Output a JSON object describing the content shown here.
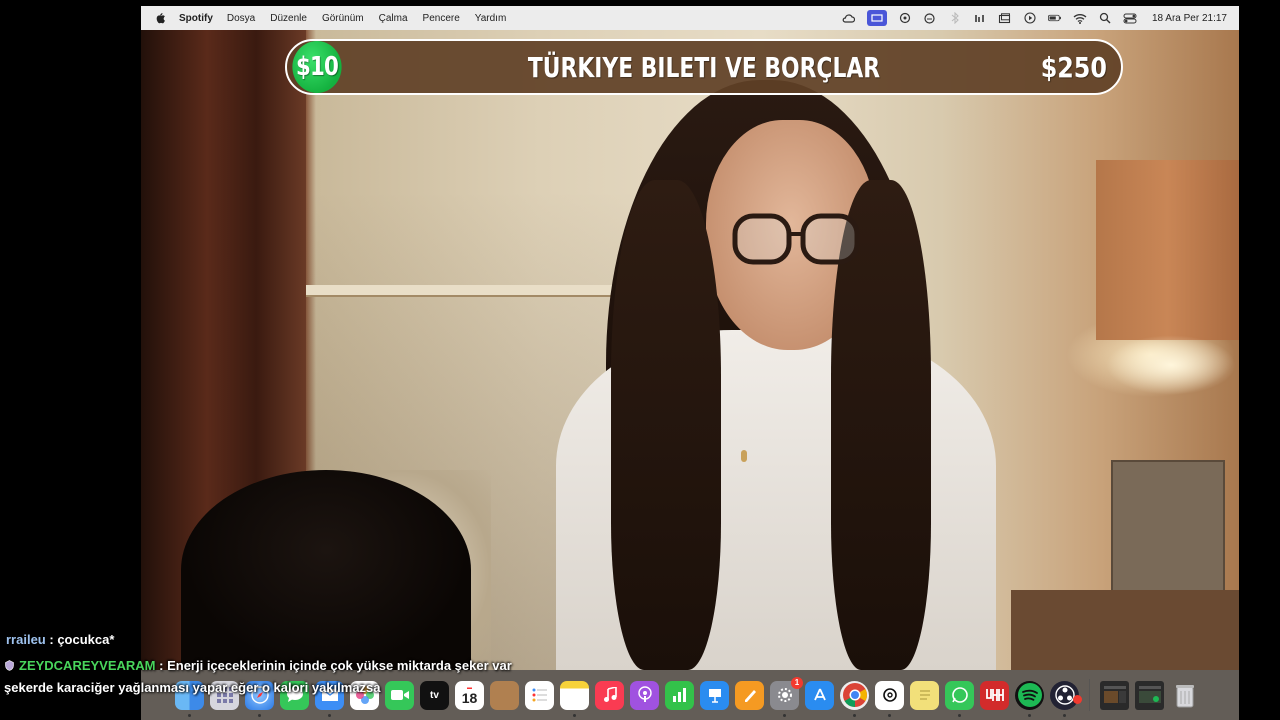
{
  "menubar": {
    "app_name": "Spotify",
    "menus": [
      "Dosya",
      "Düzenle",
      "Görünüm",
      "Çalma",
      "Pencere",
      "Yardım"
    ],
    "status_icons": [
      "creative-cloud-icon",
      "screen-mirroring-icon",
      "chatgpt-icon",
      "cloud-icon",
      "bluetooth-icon",
      "window-icon",
      "play-icon",
      "battery-icon",
      "wifi-icon",
      "search-icon",
      "control-center-icon"
    ],
    "clock": "18 Ara Per  21:17",
    "active_color": "#4a56d8"
  },
  "banner": {
    "left_amount": "$10",
    "title": "TÜRKIYE BILETI VE BORÇLAR",
    "right_amount": "$250",
    "accent_color": "#1db954"
  },
  "dock": {
    "apps": [
      {
        "name": "finder",
        "color": "#4aa3f0"
      },
      {
        "name": "launchpad",
        "color": "#d0d0d8"
      },
      {
        "name": "safari",
        "color": "#3b8ef0"
      },
      {
        "name": "messages",
        "color": "#35c759"
      },
      {
        "name": "mail",
        "color": "#3d8ef5"
      },
      {
        "name": "photos",
        "color": "#f5a623"
      },
      {
        "name": "facetime",
        "color": "#35c759"
      },
      {
        "name": "apple-tv",
        "color": "#111111",
        "label": "tv"
      },
      {
        "name": "calendar",
        "color": "#ffffff",
        "label": "18"
      },
      {
        "name": "notes-app",
        "color": "#b08050"
      },
      {
        "name": "reminders",
        "color": "#ffffff"
      },
      {
        "name": "notes",
        "color": "#f7d23a"
      },
      {
        "name": "music",
        "color": "#fa3b52"
      },
      {
        "name": "podcasts",
        "color": "#a052e0"
      },
      {
        "name": "numbers",
        "color": "#33c24a"
      },
      {
        "name": "keynote",
        "color": "#2a8cf0"
      },
      {
        "name": "pages",
        "color": "#f59a22"
      },
      {
        "name": "system-settings",
        "color": "#8a8a8f",
        "badge": "1"
      },
      {
        "name": "app-store",
        "color": "#2a8cf0"
      },
      {
        "name": "chrome",
        "color": "#e8e8e8"
      },
      {
        "name": "chatgpt",
        "color": "#ffffff"
      },
      {
        "name": "stickies",
        "color": "#f2e07a"
      },
      {
        "name": "whatsapp",
        "color": "#35c759"
      },
      {
        "name": "uhh",
        "color": "#d22b2b"
      },
      {
        "name": "spotify",
        "color": "#1db954"
      },
      {
        "name": "obs",
        "color": "#222233"
      },
      {
        "name": "screenshot-1",
        "color": "#2a2a2a"
      },
      {
        "name": "screenshot-2",
        "color": "#2a2a2a"
      },
      {
        "name": "trash",
        "color": "#c8c8cc"
      }
    ]
  },
  "chat": {
    "line1_user": "rraileu",
    "line1_message": ": çocukca*",
    "line2_user": "ZEYDCAREYVEARAM",
    "line2_message": ": Enerji içeceklerinin içinde çok yükse miktarda şeker var",
    "line3_message": "şekerde karaciğer yağlanması yapar eğer o kalori yakılmazsa"
  }
}
